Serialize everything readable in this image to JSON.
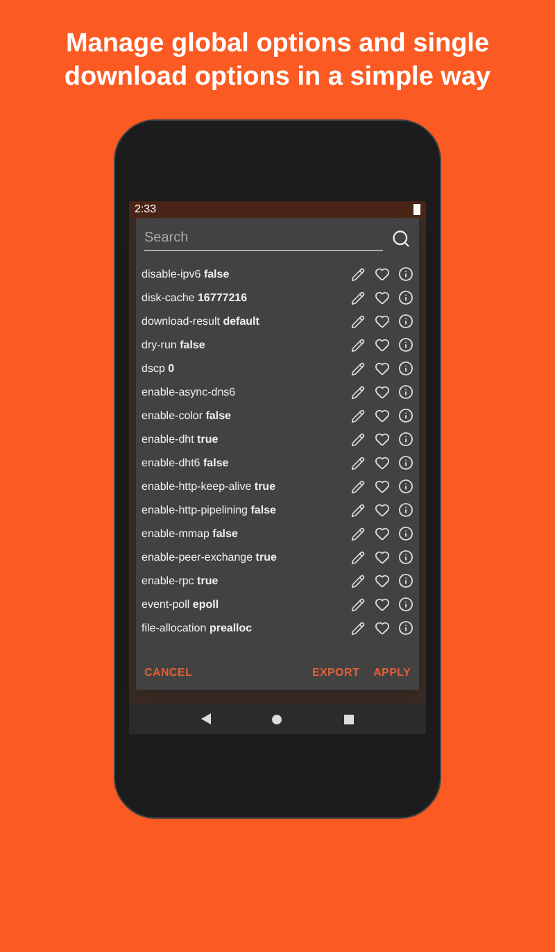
{
  "headline": "Manage global options and single download options in a simple way",
  "status_bar": {
    "time": "2:33"
  },
  "dialog": {
    "search": {
      "placeholder": "Search"
    },
    "options": [
      {
        "name": "disable-ipv6",
        "value": "false"
      },
      {
        "name": "disk-cache",
        "value": "16777216"
      },
      {
        "name": "download-result",
        "value": "default"
      },
      {
        "name": "dry-run",
        "value": "false"
      },
      {
        "name": "dscp",
        "value": "0"
      },
      {
        "name": "enable-async-dns6"
      },
      {
        "name": "enable-color",
        "value": "false"
      },
      {
        "name": "enable-dht",
        "value": "true"
      },
      {
        "name": "enable-dht6",
        "value": "false"
      },
      {
        "name": "enable-http-keep-alive",
        "value": "true"
      },
      {
        "name": "enable-http-pipelining",
        "value": "false"
      },
      {
        "name": "enable-mmap",
        "value": "false"
      },
      {
        "name": "enable-peer-exchange",
        "value": "true"
      },
      {
        "name": "enable-rpc",
        "value": "true"
      },
      {
        "name": "event-poll",
        "value": "epoll"
      },
      {
        "name": "file-allocation",
        "value": "prealloc"
      }
    ],
    "buttons": [
      {
        "label": "CANCEL"
      },
      {
        "label": "EXPORT"
      },
      {
        "label": "APPLY"
      }
    ]
  }
}
